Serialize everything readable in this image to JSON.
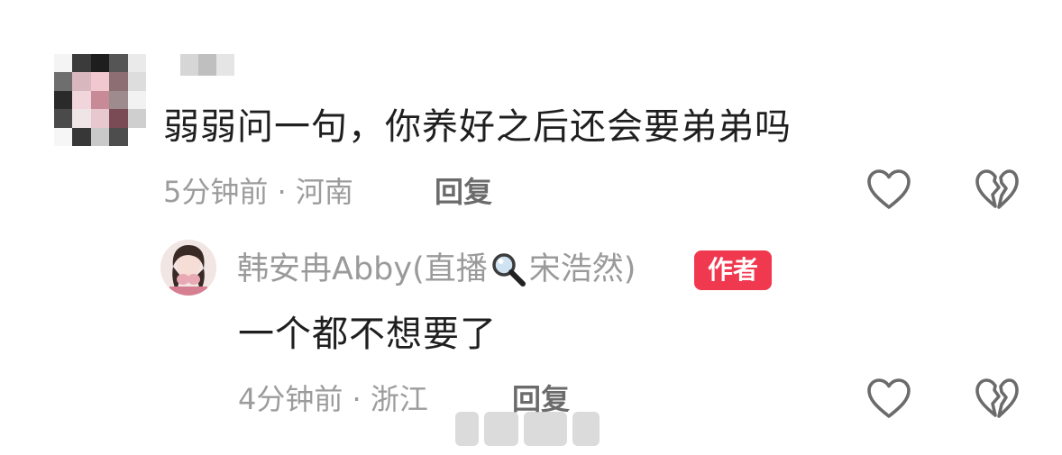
{
  "comment": {
    "username": "",
    "text": "弱弱问一句，你养好之后还会要弟弟吗",
    "time": "5分钟前",
    "separator": "·",
    "location": "河南",
    "reply_label": "回复",
    "avatar_pixels": [
      "#f4f4f4",
      "#3b3b3b",
      "#1e1e1e",
      "#555555",
      "#eaeaea",
      "#6e6e6e",
      "#d9b7bf",
      "#f1c8cf",
      "#8d6f73",
      "#dddddd",
      "#2a2a2a",
      "#f0d6dc",
      "#c98a97",
      "#9d8b8e",
      "#f2f2f2",
      "#4a4a4a",
      "#efe5e7",
      "#e7c8cf",
      "#7a4b55",
      "#cfcfcf",
      "#f6f6f6",
      "#373737",
      "#c9c9c9",
      "#4d4d4d",
      "#ffffff"
    ],
    "username_pixels": [
      "#d6d6d6",
      "#bfbfbf",
      "#e5e5e5"
    ]
  },
  "reply": {
    "username_part1": "韩安冉Abby(直播",
    "username_part2": "宋浩然)",
    "badge": "作者",
    "text": "一个都不想要了",
    "time": "4分钟前",
    "separator": "·",
    "location": "浙江",
    "reply_label": "回复"
  },
  "icons": {
    "like": "heart-outline-icon",
    "dislike": "broken-heart-icon",
    "magnifier": "magnifying-glass-icon"
  },
  "colors": {
    "badge": "#f0384f",
    "meta_text": "#9c9c9c",
    "body_text": "#1f1f1f",
    "icon_stroke": "#6b6b6b"
  }
}
